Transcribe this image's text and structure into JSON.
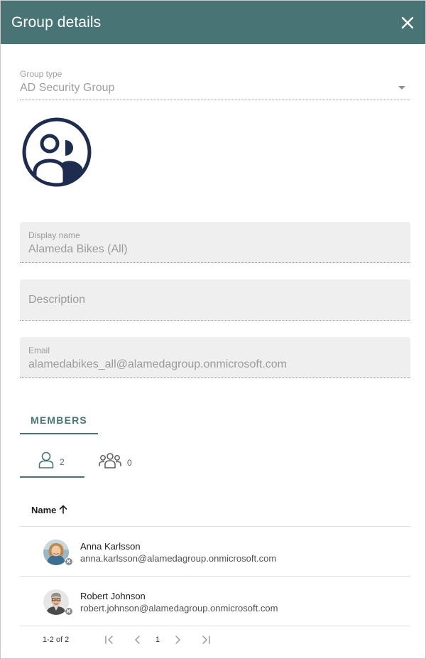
{
  "header": {
    "title": "Group details",
    "close_icon": "close-icon"
  },
  "group_type": {
    "label": "Group type",
    "value": "AD Security Group"
  },
  "fields": {
    "display_name": {
      "label": "Display name",
      "value": "Alameda Bikes (All)"
    },
    "description": {
      "placeholder": "Description"
    },
    "email": {
      "label": "Email",
      "value": "alamedabikes_all@alamedagroup.onmicrosoft.com"
    }
  },
  "tabs": {
    "members": "MEMBERS"
  },
  "subtabs": {
    "users_count": "2",
    "groups_count": "0"
  },
  "table": {
    "column_name": "Name",
    "rows": [
      {
        "name": "Anna Karlsson",
        "email": "anna.karlsson@alamedagroup.onmicrosoft.com"
      },
      {
        "name": "Robert Johnson",
        "email": "robert.johnson@alamedagroup.onmicrosoft.com"
      }
    ]
  },
  "pager": {
    "info": "1-2 of 2",
    "page": "1"
  },
  "colors": {
    "accent": "#497475",
    "icon_navy": "#1e2d4f",
    "field_bg": "#efefef"
  }
}
